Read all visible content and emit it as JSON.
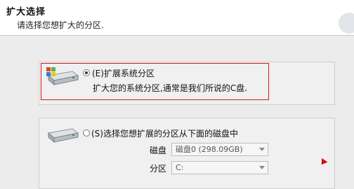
{
  "header": {
    "title": "扩大选择",
    "subtitle": "请选择您想扩大的分区."
  },
  "option1": {
    "label": "(E)扩展系统分区",
    "description": "扩大您的系统分区,通常是我们所说的C盘.",
    "selected": true,
    "icon": "hard-drive-windows-icon"
  },
  "option2": {
    "label": "(S)选择您想扩展的分区从下面的磁盘中",
    "selected": false,
    "icon": "hard-drive-icon",
    "disk_label": "磁盘",
    "disk_value": "磁盘0 (298.09GB)",
    "partition_label": "分区",
    "partition_value": "C:"
  },
  "colors": {
    "highlight": "#d01a1a",
    "header_bg": "#ffffff",
    "panel_bg": "#ececec"
  }
}
